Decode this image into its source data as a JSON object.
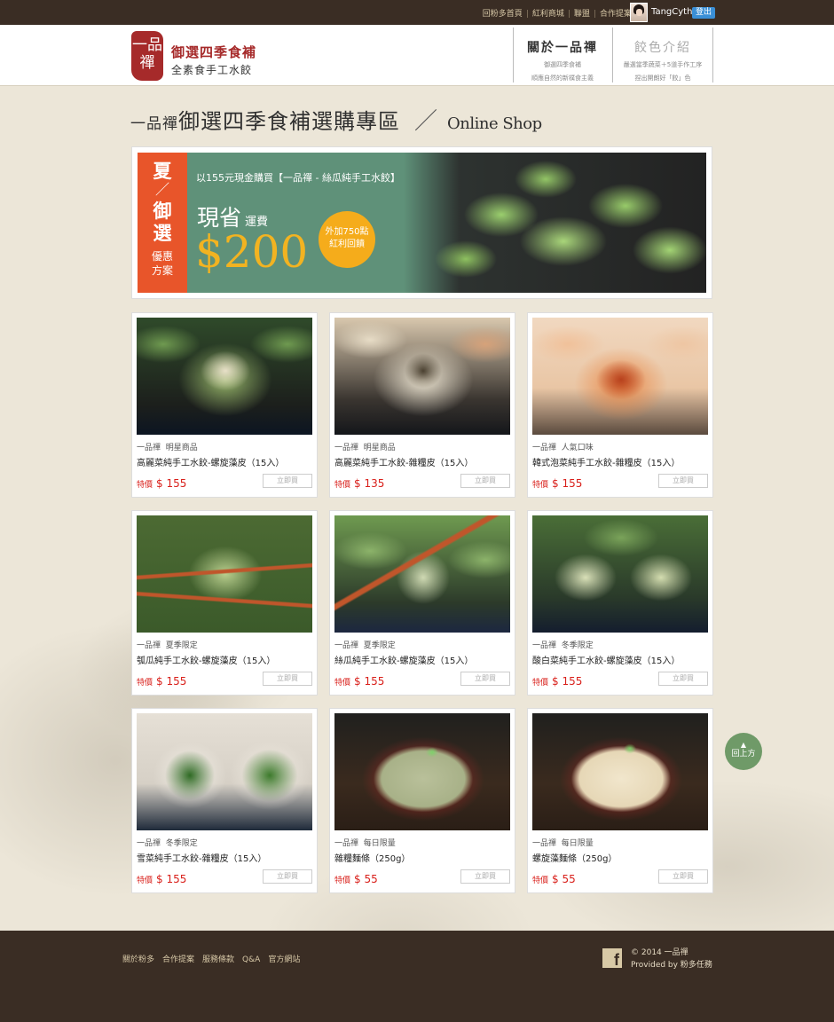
{
  "topbar": {
    "links": [
      "回粉多首頁",
      "紅利商城",
      "聯盟",
      "合作提案"
    ],
    "username": "TangCyth",
    "logout": "登出"
  },
  "header": {
    "logo_mark": "一品禪",
    "logo_title": "御選四季食補",
    "logo_subtitle": "全素食手工水餃",
    "nav": [
      {
        "title": "關於一品禪",
        "sub1": "御選四季食補",
        "sub2": "順應自然的新樸食主義",
        "state": "active"
      },
      {
        "title": "餃色介紹",
        "sub1": "嚴選當季蔬菜＋5道手作工序",
        "sub2": "捏出開朗好「餃」色",
        "state": "inactive"
      }
    ]
  },
  "page_title": {
    "brand": "一品禪",
    "title": "御選四季食補選購專區",
    "slash": "／",
    "en": "Online Shop"
  },
  "banner": {
    "badge_1": "夏",
    "badge_slash": "／",
    "badge_2": "御",
    "badge_3": "選",
    "badge_4": "優惠",
    "badge_5": "方案",
    "line": "以155元現金購買【一品禪 - 絲瓜純手工水餃】",
    "save": "現省",
    "save_sub": "運費",
    "price": "$200",
    "bonus_1": "外加750點",
    "bonus_2": "紅利回饋"
  },
  "products": [
    {
      "brand": "一品禪",
      "tag": "明星商品",
      "name": "高麗菜純手工水餃-螺旋藻皮（15入）",
      "price_label": "特價",
      "price": "$ 155",
      "buy": "立即買"
    },
    {
      "brand": "一品禪",
      "tag": "明星商品",
      "name": "高麗菜純手工水餃-雜糧皮（15入）",
      "price_label": "特價",
      "price": "$ 135",
      "buy": "立即買"
    },
    {
      "brand": "一品禪",
      "tag": "人氣口味",
      "name": "韓式泡菜純手工水餃-雜糧皮（15入）",
      "price_label": "特價",
      "price": "$ 155",
      "buy": "立即買"
    },
    {
      "brand": "一品禪",
      "tag": "夏季限定",
      "name": "瓠瓜純手工水餃-螺旋藻皮（15入）",
      "price_label": "特價",
      "price": "$ 155",
      "buy": "立即買"
    },
    {
      "brand": "一品禪",
      "tag": "夏季限定",
      "name": "絲瓜純手工水餃-螺旋藻皮（15入）",
      "price_label": "特價",
      "price": "$ 155",
      "buy": "立即買"
    },
    {
      "brand": "一品禪",
      "tag": "冬季限定",
      "name": "酸白菜純手工水餃-螺旋藻皮（15入）",
      "price_label": "特價",
      "price": "$ 155",
      "buy": "立即買"
    },
    {
      "brand": "一品禪",
      "tag": "冬季限定",
      "name": "雪菜純手工水餃-雜糧皮（15入）",
      "price_label": "特價",
      "price": "$ 155",
      "buy": "立即買"
    },
    {
      "brand": "一品禪",
      "tag": "每日限量",
      "name": "雜糧麵條（250g）",
      "price_label": "特價",
      "price": "$ 55",
      "buy": "立即買"
    },
    {
      "brand": "一品禪",
      "tag": "每日限量",
      "name": "螺旋藻麵條（250g）",
      "price_label": "特價",
      "price": "$ 55",
      "buy": "立即買"
    }
  ],
  "back_to_top": "回上方",
  "footer": {
    "links": [
      "關於粉多",
      "合作提案",
      "服務條款",
      "Q&A",
      "官方網站"
    ],
    "fb_icon": "f",
    "copyright": "© 2014 一品禪",
    "provided": "Provided by 粉多任務"
  },
  "colors": {
    "topbar": "#3a2d24",
    "accent_red": "#d9201b",
    "banner_green": "#5f9179",
    "badge_orange": "#e8552a",
    "price_gold": "#f2b321",
    "backtop_green": "#6f9a68"
  }
}
